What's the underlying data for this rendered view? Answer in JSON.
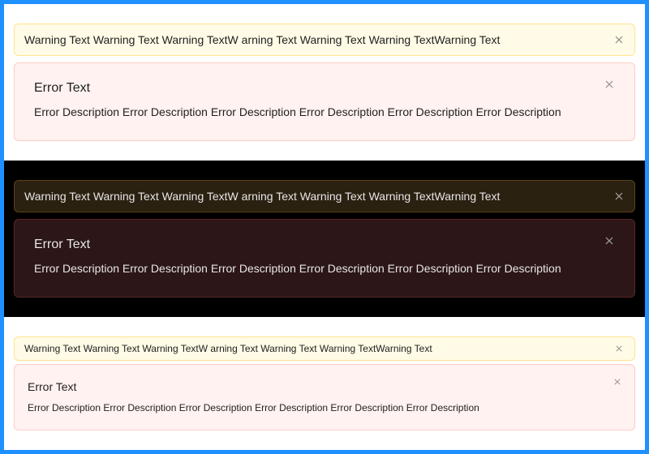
{
  "light": {
    "warning": {
      "text": "Warning Text Warning Text Warning TextW arning Text Warning Text Warning TextWarning Text"
    },
    "error": {
      "title": "Error Text",
      "description": "Error Description Error Description Error Description Error Description Error Description Error Description"
    }
  },
  "dark": {
    "warning": {
      "text": "Warning Text Warning Text Warning TextW arning Text Warning Text Warning TextWarning Text"
    },
    "error": {
      "title": "Error Text",
      "description": "Error Description Error Description Error Description Error Description Error Description Error Description"
    }
  },
  "small": {
    "warning": {
      "text": "Warning Text Warning Text Warning TextW arning Text Warning Text Warning TextWarning Text"
    },
    "error": {
      "title": "Error Text",
      "description": "Error Description Error Description Error Description Error Description Error Description Error Description"
    }
  },
  "colors": {
    "frame": "#1e90ff",
    "warning_bg": "#fffbe6",
    "warning_border": "#ffe58f",
    "error_bg": "#fff2f0",
    "error_border": "#ffccc7",
    "dark_bg": "#000000"
  },
  "icons": {
    "close": "close-icon"
  }
}
